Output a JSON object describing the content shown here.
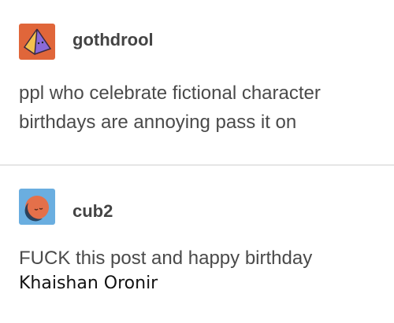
{
  "colors": {
    "avatar_1_bg": "#e0663a",
    "avatar_1_pyramid_light": "#f2c14e",
    "avatar_1_pyramid_dark": "#8a6ad8",
    "avatar_2_bg": "#6aaee0",
    "avatar_2_circle": "#e4704a",
    "text": "#444444",
    "divider": "#e6e6e6"
  },
  "posts": [
    {
      "username": "gothdrool",
      "avatar_icon": "pyramid-avatar-icon",
      "body": "ppl who celebrate fictional character birthdays are annoying pass it on"
    },
    {
      "username": "cub2",
      "avatar_icon": "sleepy-moon-avatar-icon",
      "body": "FUCK this post and happy birthday",
      "overlay_name": "Khaishan Oronir"
    }
  ]
}
